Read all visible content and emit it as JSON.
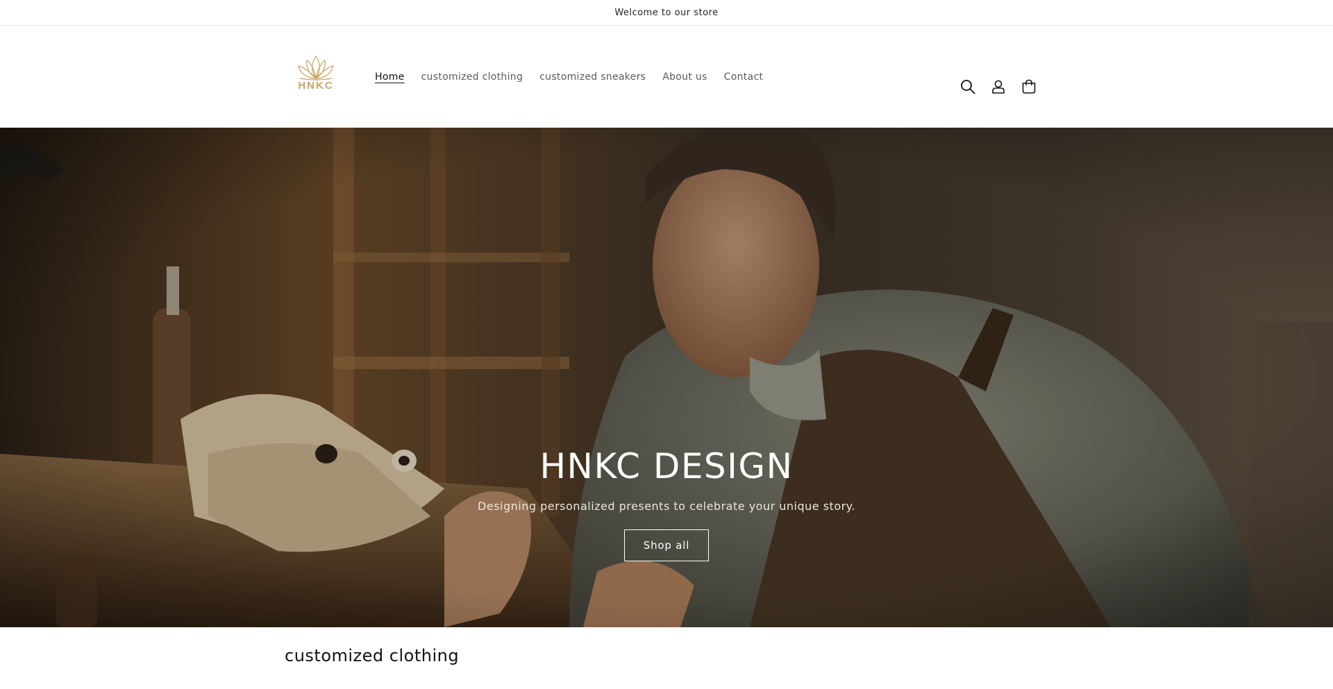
{
  "announcement": {
    "text": "Welcome to our store"
  },
  "header": {
    "logo_text": "HNKC",
    "nav": [
      {
        "label": "Home",
        "active": true
      },
      {
        "label": "customized clothing",
        "active": false
      },
      {
        "label": "customized sneakers",
        "active": false
      },
      {
        "label": "About us",
        "active": false
      },
      {
        "label": "Contact",
        "active": false
      }
    ],
    "icons": [
      "search-icon",
      "account-icon",
      "cart-icon"
    ]
  },
  "hero": {
    "title": "HNKC DESIGN",
    "subtitle": "Designing personalized presents to celebrate your unique story.",
    "button_label": "Shop all"
  },
  "collection": {
    "heading": "customized clothing"
  },
  "colors": {
    "brand_gold": "#c9a464",
    "text": "#121212",
    "nav_text": "#5a5a5a"
  }
}
